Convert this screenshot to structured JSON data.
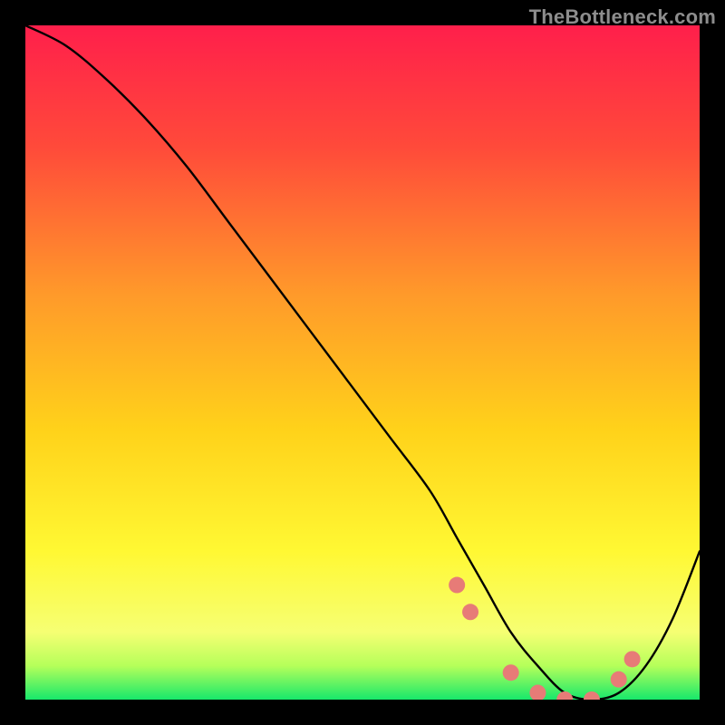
{
  "watermark": "TheBottleneck.com",
  "chart_data": {
    "type": "line",
    "title": "",
    "xlabel": "",
    "ylabel": "",
    "xlim": [
      0,
      100
    ],
    "ylim": [
      0,
      100
    ],
    "x": [
      0,
      6,
      12,
      18,
      24,
      30,
      36,
      42,
      48,
      54,
      60,
      64,
      68,
      72,
      76,
      80,
      84,
      88,
      92,
      96,
      100
    ],
    "values": [
      100,
      97,
      92,
      86,
      79,
      71,
      63,
      55,
      47,
      39,
      31,
      24,
      17,
      10,
      5,
      1,
      0,
      1,
      5,
      12,
      22
    ],
    "markers": {
      "x": [
        64,
        66,
        72,
        76,
        80,
        84,
        88,
        90
      ],
      "y": [
        17,
        13,
        4,
        1,
        0,
        0,
        3,
        6
      ]
    },
    "gradient_stops": [
      {
        "t": 0.0,
        "color": "#ff1f4b"
      },
      {
        "t": 0.18,
        "color": "#ff4a3a"
      },
      {
        "t": 0.4,
        "color": "#ff9a2a"
      },
      {
        "t": 0.6,
        "color": "#ffd21a"
      },
      {
        "t": 0.78,
        "color": "#fff833"
      },
      {
        "t": 0.9,
        "color": "#f6ff73"
      },
      {
        "t": 0.95,
        "color": "#b5ff5a"
      },
      {
        "t": 1.0,
        "color": "#17e86b"
      }
    ],
    "line_color": "#000000",
    "marker_color": "#e77b77",
    "marker_radius": 9
  }
}
